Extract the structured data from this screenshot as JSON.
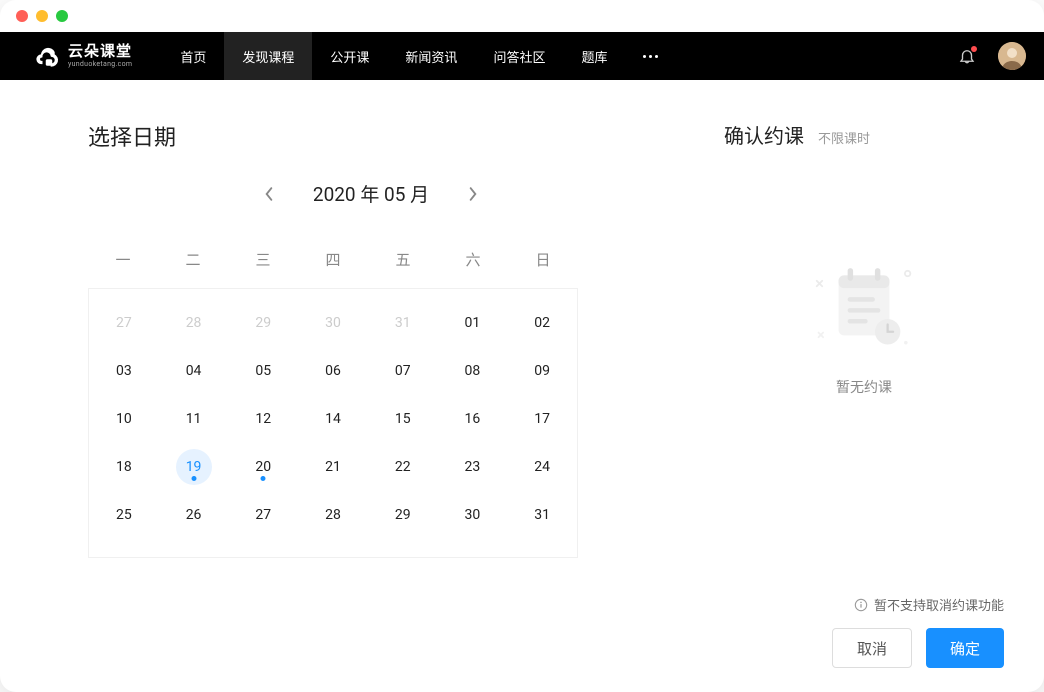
{
  "logo": {
    "main": "云朵课堂",
    "sub": "yunduoketang.com"
  },
  "nav": {
    "items": [
      {
        "label": "首页",
        "active": false
      },
      {
        "label": "发现课程",
        "active": true
      },
      {
        "label": "公开课",
        "active": false
      },
      {
        "label": "新闻资讯",
        "active": false
      },
      {
        "label": "问答社区",
        "active": false
      },
      {
        "label": "题库",
        "active": false
      }
    ]
  },
  "calendar": {
    "title": "选择日期",
    "month_label": "2020 年 05 月",
    "weekdays": [
      "一",
      "二",
      "三",
      "四",
      "五",
      "六",
      "日"
    ],
    "cells": [
      {
        "n": "27",
        "muted": true
      },
      {
        "n": "28",
        "muted": true
      },
      {
        "n": "29",
        "muted": true
      },
      {
        "n": "30",
        "muted": true
      },
      {
        "n": "31",
        "muted": true
      },
      {
        "n": "01"
      },
      {
        "n": "02"
      },
      {
        "n": "03"
      },
      {
        "n": "04"
      },
      {
        "n": "05"
      },
      {
        "n": "06"
      },
      {
        "n": "07"
      },
      {
        "n": "08"
      },
      {
        "n": "09"
      },
      {
        "n": "10"
      },
      {
        "n": "11"
      },
      {
        "n": "12"
      },
      {
        "n": "14"
      },
      {
        "n": "15"
      },
      {
        "n": "16"
      },
      {
        "n": "17"
      },
      {
        "n": "18"
      },
      {
        "n": "19",
        "today": true,
        "dot": true
      },
      {
        "n": "20",
        "dot": true
      },
      {
        "n": "21"
      },
      {
        "n": "22"
      },
      {
        "n": "23"
      },
      {
        "n": "24"
      },
      {
        "n": "25"
      },
      {
        "n": "26"
      },
      {
        "n": "27"
      },
      {
        "n": "28"
      },
      {
        "n": "29"
      },
      {
        "n": "30"
      },
      {
        "n": "31"
      }
    ]
  },
  "confirm": {
    "title": "确认约课",
    "sub": "不限课时",
    "empty": "暂无约课",
    "notice": "暂不支持取消约课功能",
    "cancel": "取消",
    "ok": "确定"
  }
}
